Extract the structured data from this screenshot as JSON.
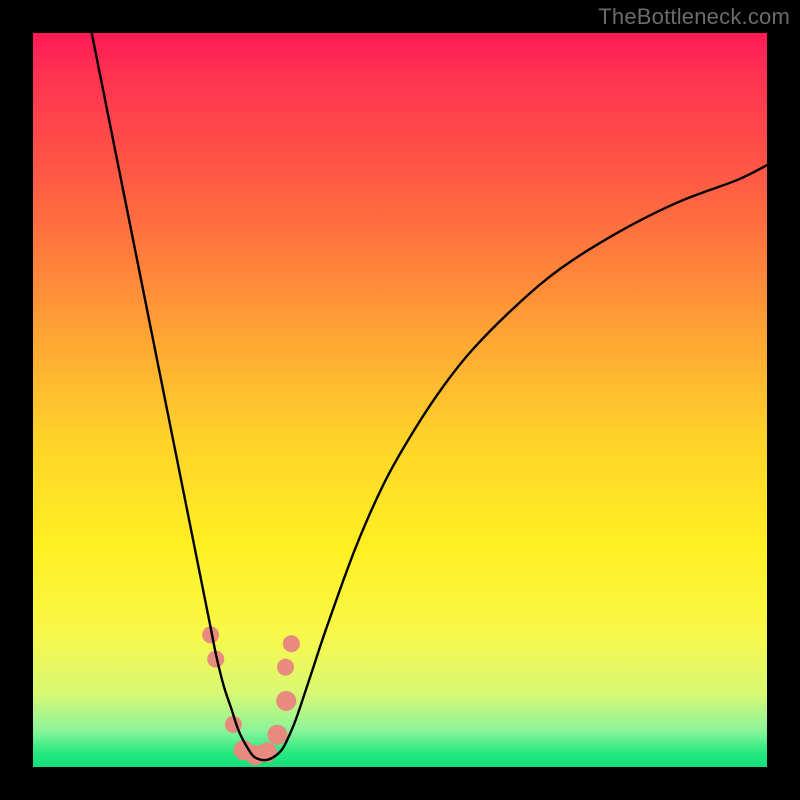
{
  "attribution": "TheBottleneck.com",
  "chart_data": {
    "type": "line",
    "title": "",
    "xlabel": "",
    "ylabel": "",
    "xlim": [
      0,
      100
    ],
    "ylim": [
      0,
      100
    ],
    "grid": false,
    "legend": false,
    "series": [
      {
        "name": "bottleneck-curve",
        "color": "#000000",
        "x": [
          8,
          10,
          12,
          14,
          16,
          18,
          20,
          22,
          24,
          25,
          26,
          27,
          28,
          29,
          30,
          31,
          32,
          33,
          34,
          35,
          36,
          38,
          40,
          44,
          48,
          52,
          56,
          60,
          66,
          72,
          80,
          88,
          96,
          100
        ],
        "y_percent_from_top": [
          0,
          10,
          20,
          30,
          40,
          50,
          60,
          70,
          80,
          85,
          89,
          92,
          95,
          97,
          98.5,
          99,
          99,
          98.5,
          97.5,
          95.5,
          93,
          87,
          81,
          70,
          61,
          54,
          48,
          43,
          37,
          32,
          27,
          23,
          20,
          18
        ]
      }
    ],
    "markers": [
      {
        "name": "left-marker-1",
        "x_pct": 24.2,
        "y_pct_from_top": 82,
        "r": 8.5,
        "color": "#e88a7e"
      },
      {
        "name": "left-marker-2",
        "x_pct": 24.9,
        "y_pct_from_top": 85.3,
        "r": 8.5,
        "color": "#e88a7e"
      },
      {
        "name": "left-marker-3",
        "x_pct": 27.3,
        "y_pct_from_top": 94.2,
        "r": 8.5,
        "color": "#e88a7e"
      },
      {
        "name": "right-marker-1",
        "x_pct": 34.4,
        "y_pct_from_top": 86.4,
        "r": 8.5,
        "color": "#e88a7e"
      },
      {
        "name": "right-marker-2",
        "x_pct": 35.2,
        "y_pct_from_top": 83.2,
        "r": 8.5,
        "color": "#e88a7e"
      },
      {
        "name": "bottom-blob-1",
        "x_pct": 28.7,
        "y_pct_from_top": 97.7,
        "r": 10,
        "color": "#e88a7e"
      },
      {
        "name": "bottom-blob-2",
        "x_pct": 30.3,
        "y_pct_from_top": 98.4,
        "r": 10,
        "color": "#e88a7e"
      },
      {
        "name": "bottom-blob-3",
        "x_pct": 31.9,
        "y_pct_from_top": 98.0,
        "r": 10,
        "color": "#e88a7e"
      },
      {
        "name": "bottom-blob-4",
        "x_pct": 33.3,
        "y_pct_from_top": 95.6,
        "r": 10,
        "color": "#e88a7e"
      },
      {
        "name": "bottom-blob-5",
        "x_pct": 34.5,
        "y_pct_from_top": 91.0,
        "r": 10,
        "color": "#e88a7e"
      }
    ]
  }
}
